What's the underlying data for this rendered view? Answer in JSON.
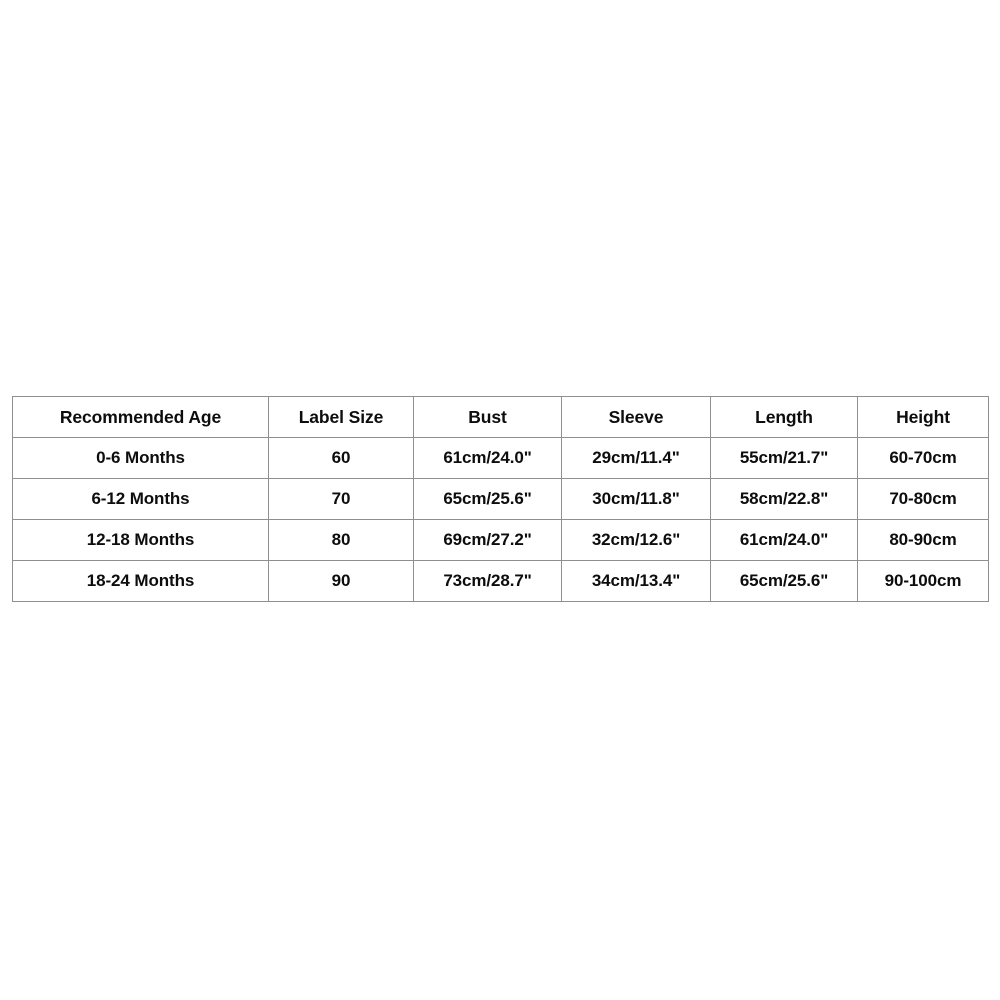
{
  "table": {
    "name": "baby-clothing-size-chart",
    "columns": [
      {
        "key": "age",
        "label": "Recommended Age"
      },
      {
        "key": "label",
        "label": "Label Size"
      },
      {
        "key": "bust",
        "label": "Bust"
      },
      {
        "key": "sleeve",
        "label": "Sleeve"
      },
      {
        "key": "length",
        "label": "Length"
      },
      {
        "key": "height",
        "label": "Height"
      }
    ],
    "rows": [
      {
        "age": "0-6 Months",
        "label": "60",
        "bust": "61cm/24.0\"",
        "sleeve": "29cm/11.4\"",
        "length": "55cm/21.7\"",
        "height": "60-70cm"
      },
      {
        "age": "6-12 Months",
        "label": "70",
        "bust": "65cm/25.6\"",
        "sleeve": "30cm/11.8\"",
        "length": "58cm/22.8\"",
        "height": "70-80cm"
      },
      {
        "age": "12-18 Months",
        "label": "80",
        "bust": "69cm/27.2\"",
        "sleeve": "32cm/12.6\"",
        "length": "61cm/24.0\"",
        "height": "80-90cm"
      },
      {
        "age": "18-24 Months",
        "label": "90",
        "bust": "73cm/28.7\"",
        "sleeve": "34cm/13.4\"",
        "length": "65cm/25.6\"",
        "height": "90-100cm"
      }
    ]
  },
  "colors": {
    "background": "#ffffff",
    "border": "#8f8f8f",
    "text": "#0d0d0d"
  }
}
